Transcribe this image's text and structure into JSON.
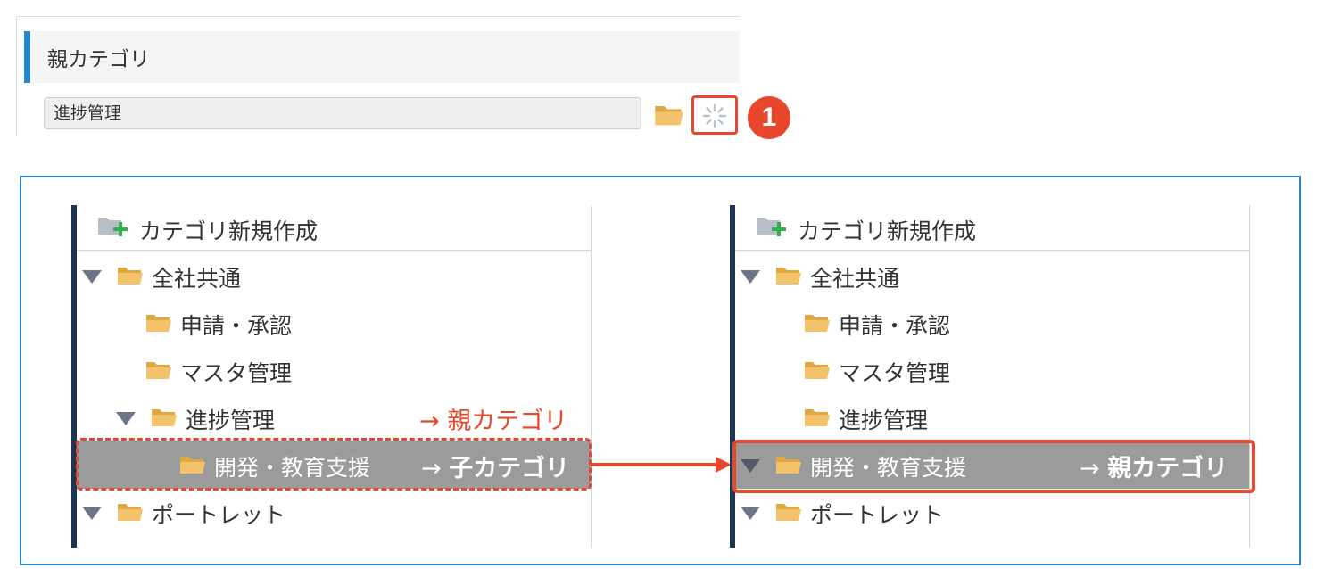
{
  "form": {
    "section_title": "親カテゴリ",
    "input_value": "進捗管理",
    "step_number": "1"
  },
  "left_tree": {
    "create_label": "カテゴリ新規作成",
    "items": [
      {
        "label": "全社共通"
      },
      {
        "label": "申請・承認"
      },
      {
        "label": "マスタ管理"
      },
      {
        "label": "進捗管理"
      },
      {
        "label": "開発・教育支援"
      },
      {
        "label": "ポートレット"
      }
    ],
    "annotation_parent": "→ 親カテゴリ",
    "annotation_child_arrow": "→ ",
    "annotation_child": "子カテゴリ"
  },
  "right_tree": {
    "create_label": "カテゴリ新規作成",
    "items": [
      {
        "label": "全社共通"
      },
      {
        "label": "申請・承認"
      },
      {
        "label": "マスタ管理"
      },
      {
        "label": "進捗管理"
      },
      {
        "label": "開発・教育支援"
      },
      {
        "label": "ポートレット"
      }
    ],
    "annotation_arrow": "→ ",
    "annotation_parent": "親カテゴリ"
  },
  "colors": {
    "accent_blue": "#1f88d1",
    "highlight_red": "#e8472b",
    "selected_row": "#9b9b9b",
    "folder": "#f0c46a",
    "tree_bar": "#1e3552"
  },
  "icons": {
    "folder": "folder-open-icon",
    "clear": "spinner-clear-icon",
    "create": "folder-add-icon",
    "expand": "triangle-down-icon"
  }
}
